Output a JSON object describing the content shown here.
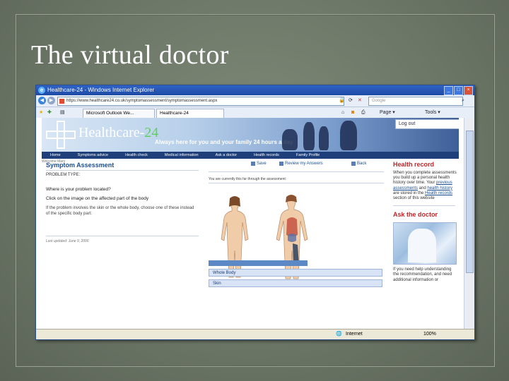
{
  "slide": {
    "title": "The virtual doctor"
  },
  "browser": {
    "window_title": "Healthcare-24 - Windows Internet Explorer",
    "address": "https://www.healthcare24.co.uk/symptomassessment/symptomassessment.aspx",
    "search_placeholder": "Google",
    "tabs": [
      "Microsoft Outlook We...",
      "Healthcare-24"
    ],
    "tools": [
      "Page",
      "Tools"
    ],
    "status_zone": "Internet",
    "zoom": "100%"
  },
  "site": {
    "brand_prefix": "Healthcare-",
    "brand_suffix": "24",
    "tagline": "Always here for you and your family 24 hours a day",
    "logout": "Log out",
    "nav": [
      "Home",
      "Symptoms advice",
      "Health check",
      "Medical information",
      "Ask a doctor",
      "Health records",
      "Family Profile"
    ],
    "welcome": "Welcome Mary",
    "heading": "Symptom Assessment",
    "problem_type": "PROBLEM TYPE:",
    "q1": "Where is your problem located?",
    "q2": "Click on the image on the affected part of the body",
    "q3": "If the problem involves the skin or the whole body, choose one of these instead of the specific body part:",
    "updated": "Last updated: June 9, 2006",
    "actions": {
      "save": "Save",
      "review": "Review my Answers",
      "back": "Back"
    },
    "progress": "You are currently this far through the assessment:",
    "options": [
      "Whole Body",
      "Skin"
    ],
    "sidebar": {
      "record_heading": "Health record",
      "record_text_1": "When you complete assessments you build up a personal health history over time. Your ",
      "record_link_1": "previous assessments",
      "record_text_2": " and ",
      "record_link_2": "health history",
      "record_text_3": " are stored in the ",
      "record_link_3": "Health records",
      "record_text_4": " section of this website",
      "doctor_heading": "Ask the doctor",
      "doctor_text": "If you need help understanding the recommendation, and need additional information or"
    }
  },
  "colors": {
    "accent": "#1b4f91",
    "sidebar_heading": "#c0282a",
    "brand_green": "#5dd05f"
  }
}
